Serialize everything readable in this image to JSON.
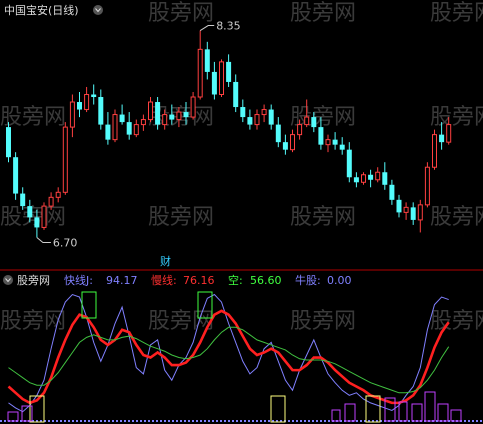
{
  "main_panel": {
    "title": "中国宝安(日线)",
    "high_label": "8.35",
    "low_label": "6.70",
    "marker_text": "财"
  },
  "indicator_panel": {
    "name": "股旁网",
    "legend": [
      {
        "label": "快线J:",
        "value": "94.17",
        "color": "#8080ff"
      },
      {
        "label": "慢线:",
        "value": "76.16",
        "color": "#ff3030"
      },
      {
        "label": "空:",
        "value": "56.60",
        "color": "#40ff40"
      },
      {
        "label": "牛股:",
        "value": "0.00",
        "color": "#8080ff"
      }
    ]
  },
  "watermark": "股旁网",
  "colors": {
    "up": "#ff4040",
    "down": "#54fcfc",
    "fast": "#8080ff",
    "slow": "#ff2020",
    "empty": "#40c040",
    "box_green": "#40ff40",
    "box_yellow": "#ffff80",
    "box_magenta": "#c040ff"
  },
  "chart_data": [
    {
      "type": "candlestick",
      "title": "中国宝安(日线)",
      "high": 8.35,
      "low": 6.7,
      "ylim": [
        6.6,
        8.45
      ],
      "candles": [
        [
          7.58,
          7.62,
          7.3,
          7.34
        ],
        [
          7.34,
          7.38,
          7.0,
          7.05
        ],
        [
          7.05,
          7.1,
          6.92,
          6.95
        ],
        [
          6.95,
          7.0,
          6.82,
          6.86
        ],
        [
          6.86,
          6.92,
          6.7,
          6.78
        ],
        [
          6.78,
          6.98,
          6.76,
          6.95
        ],
        [
          6.95,
          7.06,
          6.92,
          7.02
        ],
        [
          7.02,
          7.1,
          6.98,
          7.06
        ],
        [
          7.06,
          7.62,
          7.04,
          7.58
        ],
        [
          7.58,
          7.84,
          7.5,
          7.78
        ],
        [
          7.78,
          7.86,
          7.66,
          7.72
        ],
        [
          7.72,
          7.9,
          7.7,
          7.84
        ],
        [
          7.84,
          7.92,
          7.76,
          7.82
        ],
        [
          7.82,
          7.88,
          7.56,
          7.6
        ],
        [
          7.6,
          7.7,
          7.44,
          7.48
        ],
        [
          7.48,
          7.72,
          7.46,
          7.68
        ],
        [
          7.68,
          7.76,
          7.6,
          7.62
        ],
        [
          7.62,
          7.7,
          7.48,
          7.52
        ],
        [
          7.52,
          7.64,
          7.5,
          7.6
        ],
        [
          7.6,
          7.68,
          7.55,
          7.64
        ],
        [
          7.64,
          7.82,
          7.62,
          7.78
        ],
        [
          7.78,
          7.82,
          7.56,
          7.6
        ],
        [
          7.6,
          7.72,
          7.56,
          7.68
        ],
        [
          7.68,
          7.76,
          7.6,
          7.64
        ],
        [
          7.64,
          7.74,
          7.58,
          7.7
        ],
        [
          7.7,
          7.78,
          7.6,
          7.66
        ],
        [
          7.66,
          7.86,
          7.64,
          7.82
        ],
        [
          7.82,
          8.35,
          7.8,
          8.2
        ],
        [
          8.2,
          8.26,
          7.96,
          8.02
        ],
        [
          8.02,
          8.1,
          7.8,
          7.84
        ],
        [
          7.84,
          8.12,
          7.82,
          8.1
        ],
        [
          8.1,
          8.16,
          7.9,
          7.94
        ],
        [
          7.94,
          8.0,
          7.7,
          7.74
        ],
        [
          7.74,
          7.8,
          7.62,
          7.66
        ],
        [
          7.66,
          7.72,
          7.56,
          7.6
        ],
        [
          7.6,
          7.72,
          7.56,
          7.68
        ],
        [
          7.68,
          7.76,
          7.62,
          7.72
        ],
        [
          7.72,
          7.76,
          7.56,
          7.6
        ],
        [
          7.6,
          7.66,
          7.42,
          7.46
        ],
        [
          7.46,
          7.52,
          7.36,
          7.4
        ],
        [
          7.4,
          7.56,
          7.38,
          7.52
        ],
        [
          7.52,
          7.64,
          7.48,
          7.6
        ],
        [
          7.6,
          7.8,
          7.58,
          7.66
        ],
        [
          7.66,
          7.7,
          7.54,
          7.58
        ],
        [
          7.58,
          7.66,
          7.4,
          7.44
        ],
        [
          7.44,
          7.52,
          7.38,
          7.48
        ],
        [
          7.48,
          7.54,
          7.4,
          7.44
        ],
        [
          7.44,
          7.5,
          7.36,
          7.4
        ],
        [
          7.4,
          7.46,
          7.14,
          7.18
        ],
        [
          7.18,
          7.22,
          7.1,
          7.14
        ],
        [
          7.14,
          7.22,
          7.12,
          7.2
        ],
        [
          7.2,
          7.24,
          7.1,
          7.16
        ],
        [
          7.16,
          7.26,
          7.14,
          7.22
        ],
        [
          7.22,
          7.3,
          7.08,
          7.12
        ],
        [
          7.12,
          7.16,
          6.96,
          7.0
        ],
        [
          7.0,
          7.04,
          6.86,
          6.9
        ],
        [
          6.9,
          6.98,
          6.84,
          6.94
        ],
        [
          6.94,
          6.98,
          6.8,
          6.84
        ],
        [
          6.84,
          7.0,
          6.74,
          6.96
        ],
        [
          6.96,
          7.3,
          6.94,
          7.26
        ],
        [
          7.26,
          7.56,
          7.24,
          7.52
        ],
        [
          7.52,
          7.62,
          7.4,
          7.46
        ],
        [
          7.46,
          7.66,
          7.44,
          7.6
        ]
      ]
    },
    {
      "type": "line",
      "title": "股旁网",
      "ylim": [
        0,
        100
      ],
      "series": [
        {
          "name": "快线J",
          "latest": 94.17,
          "values": [
            12,
            8,
            5,
            10,
            18,
            30,
            55,
            78,
            92,
            98,
            96,
            80,
            60,
            45,
            58,
            75,
            88,
            65,
            40,
            35,
            58,
            62,
            38,
            30,
            42,
            48,
            60,
            80,
            95,
            98,
            92,
            75,
            60,
            45,
            35,
            40,
            55,
            60,
            45,
            30,
            22,
            38,
            50,
            62,
            48,
            35,
            28,
            22,
            18,
            20,
            15,
            12,
            10,
            8,
            6,
            10,
            18,
            25,
            40,
            70,
            90,
            96,
            94
          ]
        },
        {
          "name": "慢线",
          "latest": 76.16,
          "values": [
            25,
            20,
            15,
            12,
            14,
            20,
            32,
            48,
            62,
            74,
            82,
            80,
            72,
            62,
            58,
            62,
            70,
            68,
            58,
            50,
            48,
            52,
            48,
            42,
            42,
            44,
            50,
            60,
            72,
            82,
            85,
            82,
            75,
            65,
            55,
            50,
            52,
            55,
            52,
            45,
            38,
            38,
            42,
            48,
            48,
            44,
            38,
            33,
            28,
            25,
            22,
            18,
            16,
            14,
            12,
            12,
            14,
            18,
            26,
            40,
            56,
            68,
            76
          ]
        },
        {
          "name": "空",
          "latest": 56.6,
          "values": [
            40,
            36,
            32,
            28,
            26,
            26,
            30,
            36,
            44,
            52,
            60,
            64,
            66,
            64,
            62,
            62,
            64,
            65,
            63,
            60,
            57,
            55,
            53,
            50,
            48,
            47,
            48,
            50,
            55,
            62,
            68,
            72,
            72,
            70,
            66,
            62,
            60,
            58,
            56,
            54,
            50,
            47,
            46,
            46,
            46,
            45,
            43,
            40,
            37,
            34,
            31,
            28,
            26,
            24,
            22,
            20,
            20,
            21,
            24,
            30,
            38,
            48,
            56.6
          ]
        }
      ],
      "bull_value": 0.0
    }
  ]
}
